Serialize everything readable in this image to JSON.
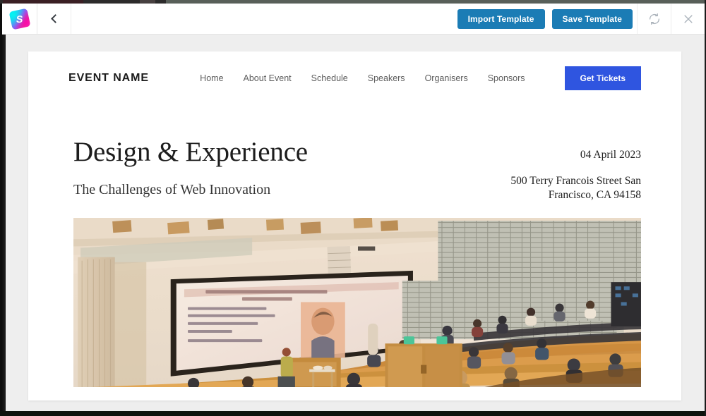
{
  "toolbar": {
    "logo_icon": "strikingly-logo-icon",
    "logo_letter": "S",
    "back_icon": "chevron-left-icon",
    "import_label": "Import Template",
    "save_label": "Save Template",
    "refresh_icon": "refresh-icon",
    "close_icon": "close-icon",
    "primary_color": "#1b7cb5"
  },
  "site": {
    "brand": "EVENT NAME",
    "nav": [
      {
        "label": "Home"
      },
      {
        "label": "About Event"
      },
      {
        "label": "Schedule"
      },
      {
        "label": "Speakers"
      },
      {
        "label": "Organisers"
      },
      {
        "label": "Sponsors"
      }
    ],
    "cta": {
      "label": "Get Tickets",
      "color": "#2f55e0"
    },
    "hero": {
      "title": "Design & Experience",
      "subtitle": "The Challenges of Web Innovation",
      "date": "04 April 2023",
      "address_line1": "500 Terry Francois Street San",
      "address_line2": "Francisco, CA 94158",
      "photo_alt": "lecture-hall-auditorium-photo"
    }
  }
}
